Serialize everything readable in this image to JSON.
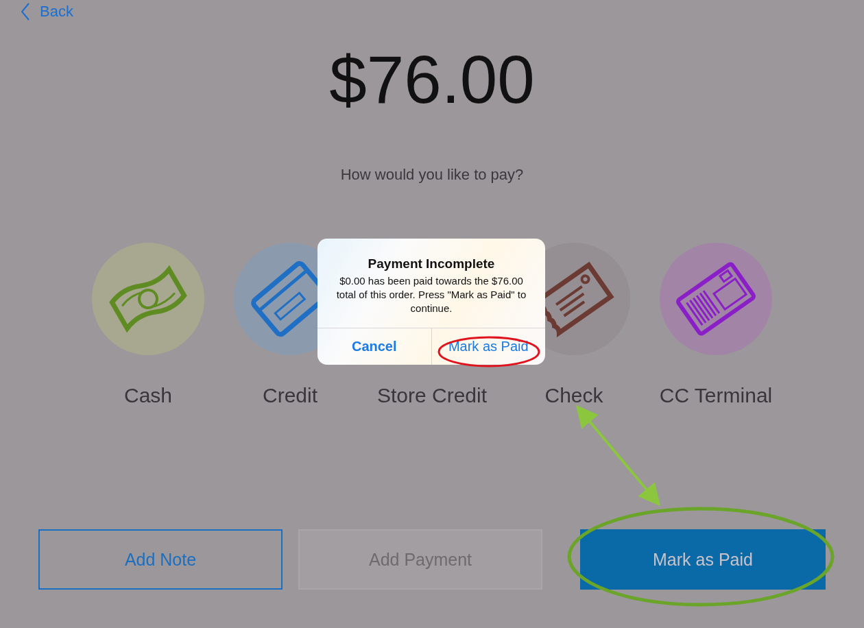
{
  "back": {
    "label": "Back"
  },
  "amount": "$76.00",
  "prompt": "How would you like to pay?",
  "methods": [
    {
      "kind": "cash",
      "label": "Cash",
      "color": "#a7a88f"
    },
    {
      "kind": "credit",
      "label": "Credit",
      "color": "#8c9aae"
    },
    {
      "kind": "store_credit",
      "label": "Store Credit"
    },
    {
      "kind": "check",
      "label": "Check",
      "color": "#958e92"
    },
    {
      "kind": "terminal",
      "label": "CC Terminal",
      "color": "#a285a6"
    }
  ],
  "actions": [
    {
      "kind": "outline",
      "label": "Add Note"
    },
    {
      "kind": "disabled",
      "label": "Add Payment"
    },
    {
      "kind": "primary",
      "label": "Mark as Paid"
    }
  ],
  "dialog": {
    "title": "Payment Incomplete",
    "message": "$0.00 has been paid towards the $76.00 total of this order. Press \"Mark as Paid\" to continue.",
    "buttons": [
      {
        "kind": "cancel",
        "label": "Cancel"
      },
      {
        "kind": "default",
        "label": "Mark as Paid"
      }
    ]
  }
}
